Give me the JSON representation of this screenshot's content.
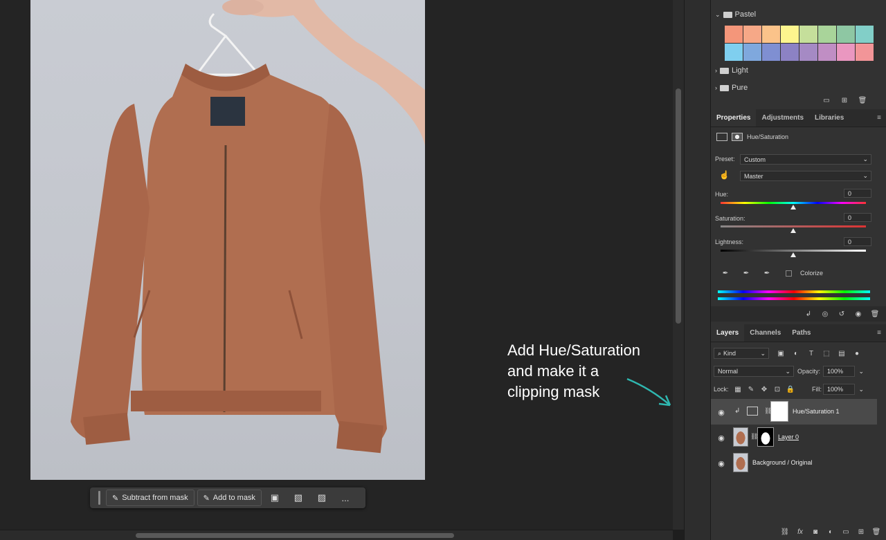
{
  "toolbar_context": {
    "subtract_label": "Subtract from mask",
    "add_label": "Add to mask",
    "more_label": "..."
  },
  "annotation": {
    "line1": "Add Hue/Saturation",
    "line2": "and make it a",
    "line3": "clipping mask"
  },
  "swatches": {
    "folder_pastel": "Pastel",
    "folder_light": "Light",
    "folder_pure": "Pure",
    "colors_row1": [
      "#f4967a",
      "#f6a887",
      "#fbc38a",
      "#fdf58e",
      "#c5df9b",
      "#a9d49a",
      "#8ec7a3",
      "#82cfc8"
    ],
    "colors_row2": [
      "#7fcfef",
      "#7fa8dd",
      "#7f8fd2",
      "#8c82c4",
      "#a58ac4",
      "#c08ec4",
      "#ea97c0",
      "#f29598"
    ]
  },
  "properties": {
    "tabs": [
      "Properties",
      "Adjustments",
      "Libraries"
    ],
    "adjustment_name": "Hue/Saturation",
    "preset_label": "Preset:",
    "preset_value": "Custom",
    "channel_value": "Master",
    "hue_label": "Hue:",
    "hue_value": "0",
    "saturation_label": "Saturation:",
    "saturation_value": "0",
    "lightness_label": "Lightness:",
    "lightness_value": "0",
    "colorize_label": "Colorize"
  },
  "layers": {
    "tabs": [
      "Layers",
      "Channels",
      "Paths"
    ],
    "kind_label": "Kind",
    "blend_mode": "Normal",
    "opacity_label": "Opacity:",
    "opacity_value": "100%",
    "lock_label": "Lock:",
    "fill_label": "Fill:",
    "fill_value": "100%",
    "items": [
      {
        "name": "Hue/Saturation 1"
      },
      {
        "name": "Layer 0"
      },
      {
        "name": "Background / Original"
      }
    ]
  },
  "colors": {
    "panel_bg": "#323232",
    "annotation_arrow": "#2fb7b0",
    "selected_layer": "#4a4a4a"
  }
}
